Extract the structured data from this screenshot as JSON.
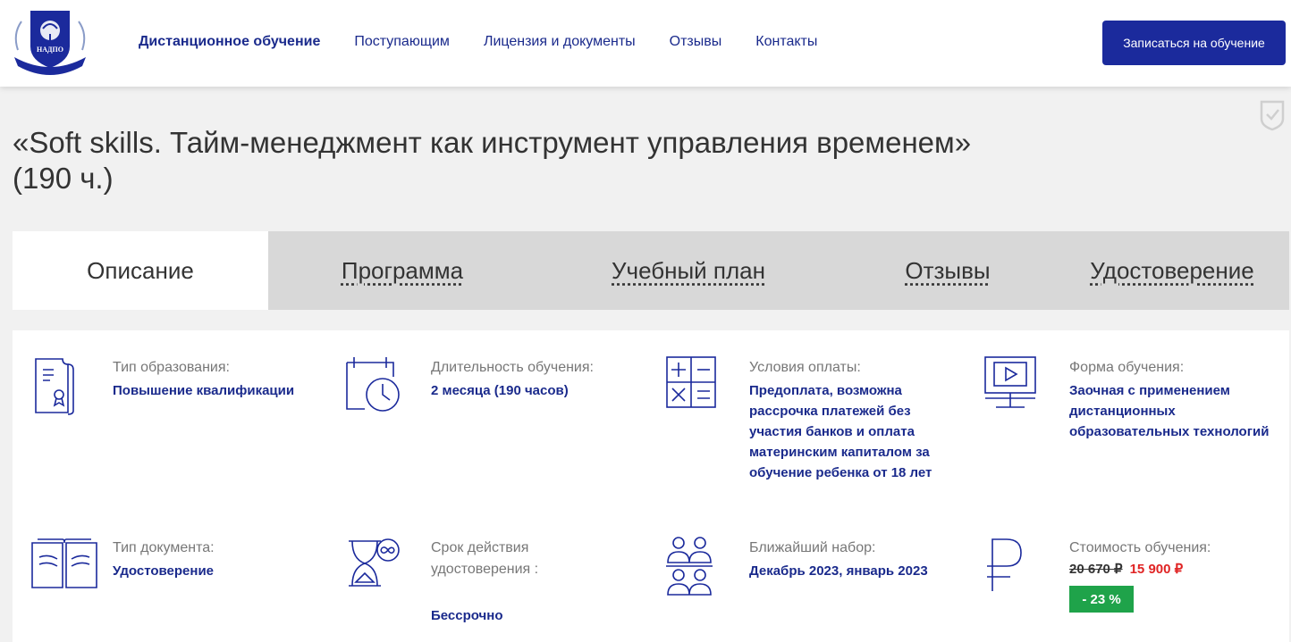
{
  "header": {
    "nav": [
      {
        "label": "Дистанционное обучение",
        "active": true
      },
      {
        "label": "Поступающим",
        "active": false
      },
      {
        "label": "Лицензия и документы",
        "active": false
      },
      {
        "label": "Отзывы",
        "active": false
      },
      {
        "label": "Контакты",
        "active": false
      }
    ],
    "cta_label": "Записаться на обучение",
    "logo_text": "НАДПО"
  },
  "course": {
    "title": "«Soft skills. Тайм-менеджмент как инструмент управления временем» (190 ч.)"
  },
  "tabs": [
    "Описание",
    "Программа",
    "Учебный план",
    "Отзывы",
    "Удостоверение"
  ],
  "details": {
    "education_type": {
      "label": "Тип образования:",
      "value": "Повышение квалификации",
      "icon": "certificate-scroll-icon"
    },
    "duration": {
      "label": "Длительность обучения:",
      "value": "2 месяца (190 часов)",
      "icon": "calendar-clock-icon"
    },
    "payment": {
      "label": "Условия оплаты:",
      "value": "Предоплата, возможна рассрочка платежей без участия банков и оплата материнским капиталом за обучение ребенка от 18 лет",
      "icon": "calculator-icon"
    },
    "form": {
      "label": "Форма обучения:",
      "value": "Заочная с применением дистанционных образовательных технологий",
      "icon": "monitor-play-icon"
    },
    "document_type": {
      "label": "Тип документа:",
      "value": "Удостоверение",
      "icon": "open-book-icon"
    },
    "validity": {
      "label": "Срок действия удостоверения :",
      "value": "Бессрочно",
      "icon": "hourglass-infinity-icon"
    },
    "next_intake": {
      "label": "Ближайший набор:",
      "value": "Декабрь 2023, январь 2023",
      "icon": "people-group-icon"
    },
    "price": {
      "label": "Стоимость обучения:",
      "old": "20 670 ₽",
      "new": "15 900 ₽",
      "discount": "- 23 %",
      "icon": "ruble-icon"
    }
  },
  "colors": {
    "brand": "#1b2a9c",
    "price_new": "#e02424",
    "discount_bg": "#1fa34a"
  }
}
